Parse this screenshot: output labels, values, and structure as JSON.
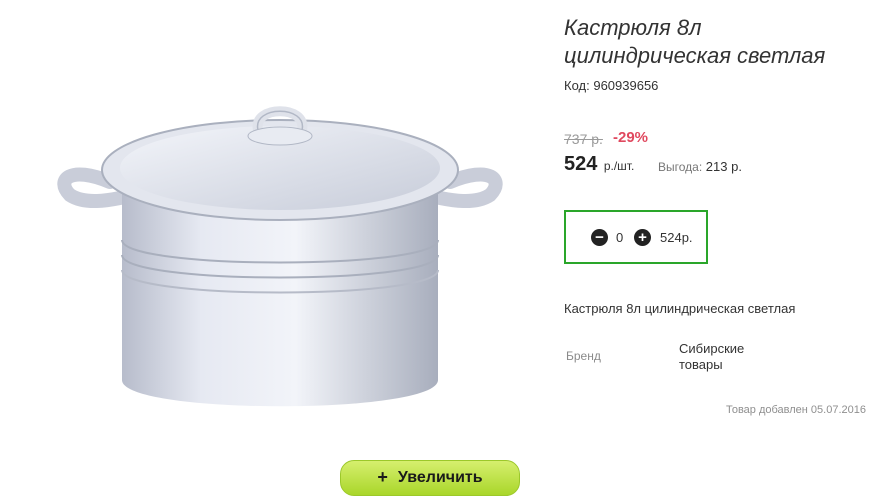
{
  "product": {
    "title": "Кастрюля 8л цилиндрическая светлая",
    "code_label": "Код:",
    "code_value": "960939656",
    "image_alt": "enamel-pot-with-lid"
  },
  "pricing": {
    "old_price": "737 р.",
    "discount": "-29%",
    "price": "524",
    "unit": "р./шт.",
    "benefit_label": "Выгода:",
    "benefit_value": "213 р."
  },
  "cart": {
    "quantity": "0",
    "total": "524р.",
    "minus_icon": "minus-circle-icon",
    "plus_icon": "plus-circle-icon"
  },
  "details": {
    "description": "Кастрюля 8л цилиндрическая светлая",
    "brand_label": "Бренд",
    "brand_value": "Сибирские товары",
    "added_text": "Товар добавлен 05.07.2016"
  },
  "actions": {
    "zoom_label": "Увеличить",
    "zoom_icon": "plus"
  },
  "colors": {
    "discount": "#e0495f",
    "qty_border": "#2aa62a",
    "zoom_button": "#b8e03a"
  }
}
